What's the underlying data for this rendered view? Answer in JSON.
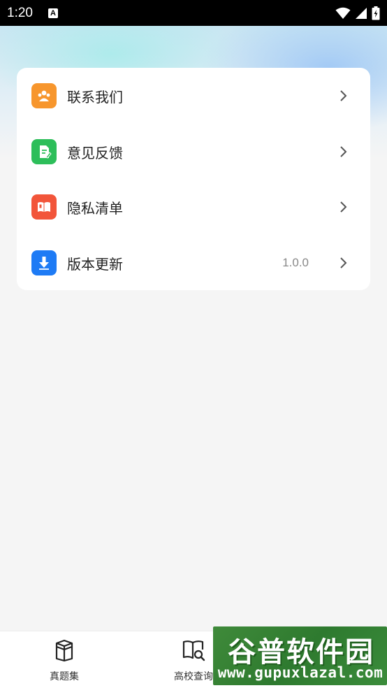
{
  "status_bar": {
    "time": "1:20",
    "notification_icon": "a-icon",
    "indicators": [
      "wifi-icon",
      "signal-icon",
      "battery-icon"
    ]
  },
  "menu": {
    "items": [
      {
        "label": "联系我们",
        "value": "",
        "icon": "contact-icon",
        "color": "#F7962D"
      },
      {
        "label": "意见反馈",
        "value": "",
        "icon": "feedback-icon",
        "color": "#2DBE5A"
      },
      {
        "label": "隐私清单",
        "value": "",
        "icon": "privacy-book-icon",
        "color": "#F2553A"
      },
      {
        "label": "版本更新",
        "value": "1.0.0",
        "icon": "download-icon",
        "color": "#1E7BF5"
      }
    ]
  },
  "bottom_nav": {
    "items": [
      {
        "label": "真题集",
        "icon": "box-book-icon"
      },
      {
        "label": "高校查询",
        "icon": "book-search-icon"
      }
    ]
  },
  "watermark": {
    "title": "谷普软件园",
    "url": "www.gupuxlazal.com"
  }
}
